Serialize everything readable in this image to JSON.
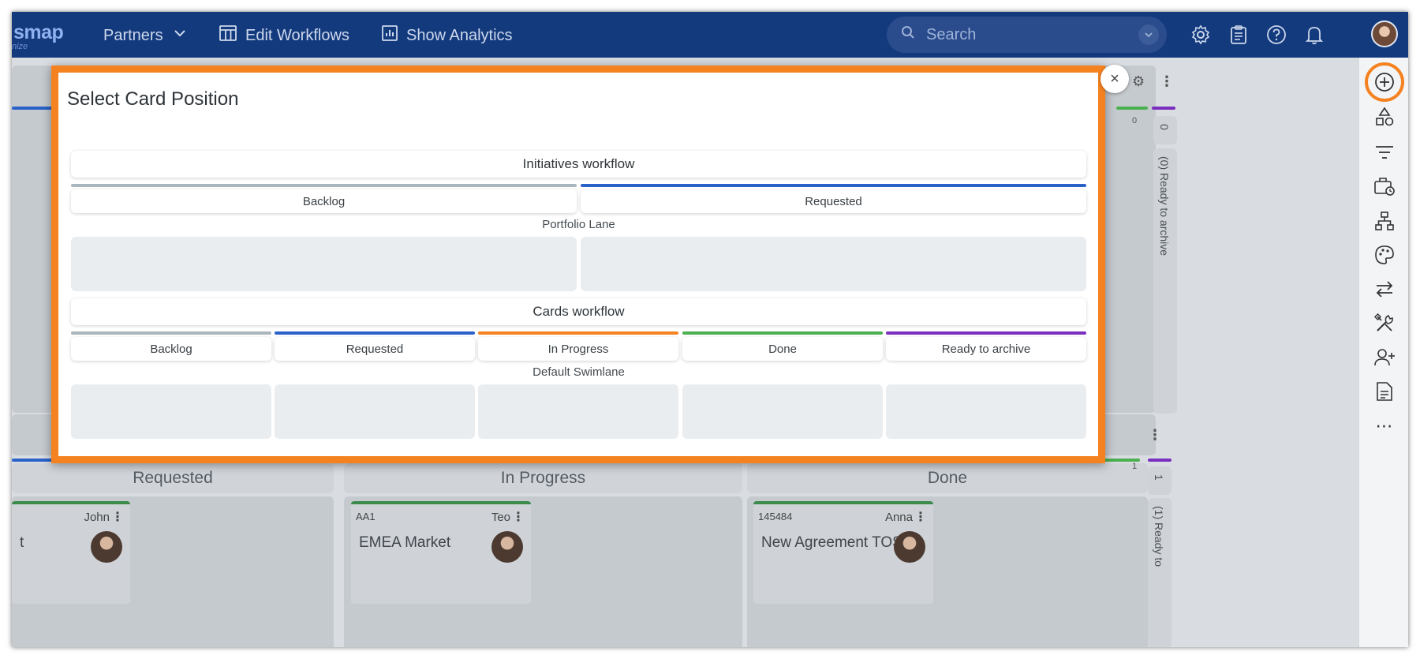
{
  "app": {
    "logo_text": "smap",
    "logo_subtext": "nize"
  },
  "topbar": {
    "nav": [
      {
        "label": "Partners",
        "icon": "chevron-down-icon"
      },
      {
        "label": "Edit Workflows",
        "icon": "table-icon"
      },
      {
        "label": "Show Analytics",
        "icon": "bar-chart-icon"
      }
    ],
    "search_placeholder": "Search",
    "icons": [
      "gear-icon",
      "clipboard-icon",
      "help-icon",
      "bell-icon",
      "user-avatar"
    ]
  },
  "sidebar": {
    "items": [
      "add-circle-icon",
      "shapes-icon",
      "filter-icon",
      "briefcase-clock-icon",
      "hierarchy-icon",
      "palette-icon",
      "swap-arrows-icon",
      "tools-icon",
      "add-user-icon",
      "document-icon",
      "more-icon"
    ]
  },
  "background_board": {
    "columns": [
      {
        "label": "Requested"
      },
      {
        "label": "In Progress"
      },
      {
        "label": "Done"
      }
    ],
    "cards": [
      {
        "id": "",
        "owner": "John",
        "title": "t"
      },
      {
        "id": "AA1",
        "owner": "Teo",
        "title": "EMEA Market"
      },
      {
        "id": "145484",
        "owner": "Anna",
        "title": "New Agreement TOS"
      }
    ],
    "archive_top": {
      "count": "0",
      "label": "(0) Ready to archive",
      "badge": "0"
    },
    "archive_bottom": {
      "count": "1",
      "label": "(1) Ready to",
      "badge": "1"
    }
  },
  "modal": {
    "title": "Select Card Position",
    "close_label": "×",
    "workflows": [
      {
        "name": "Initiatives workflow",
        "columns": [
          {
            "label": "Backlog",
            "color": "#a9b6bd"
          },
          {
            "label": "Requested",
            "color": "#2a62c9"
          }
        ],
        "lane": "Portfolio Lane"
      },
      {
        "name": "Cards workflow",
        "columns": [
          {
            "label": "Backlog",
            "color": "#a9b6bd"
          },
          {
            "label": "Requested",
            "color": "#2a62c9"
          },
          {
            "label": "In Progress",
            "color": "#f58220"
          },
          {
            "label": "Done",
            "color": "#4caf50"
          },
          {
            "label": "Ready to archive",
            "color": "#7b2fbe"
          }
        ],
        "lane": "Default Swimlane"
      }
    ]
  },
  "colors": {
    "accent_orange": "#f58220",
    "topbar_blue": "#143a7e"
  }
}
